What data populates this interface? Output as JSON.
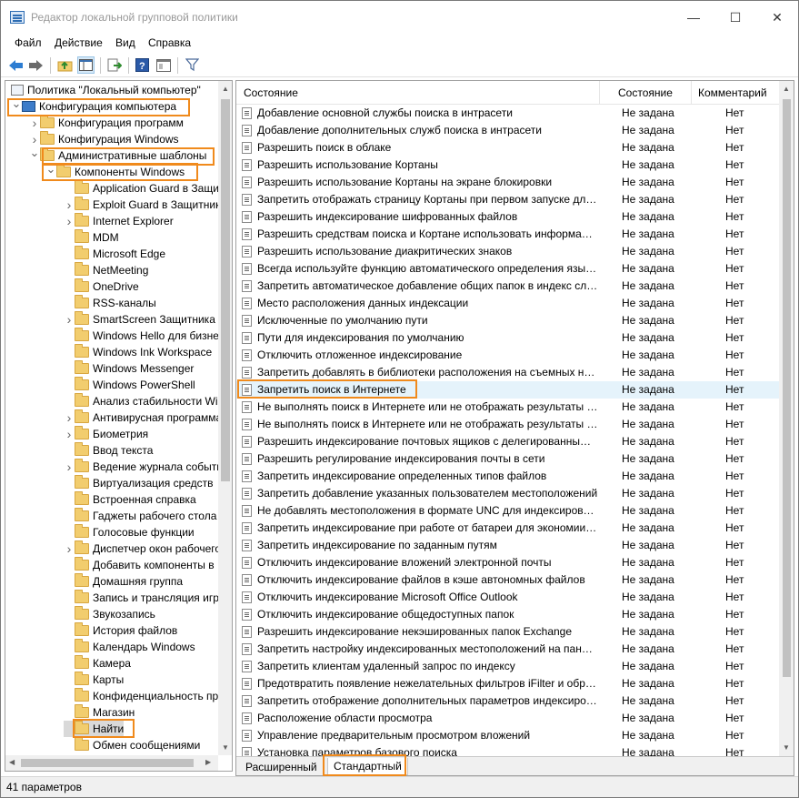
{
  "window": {
    "title": "Редактор локальной групповой политики",
    "minimize": "—",
    "maximize": "☐",
    "close": "✕"
  },
  "menu": [
    "Файл",
    "Действие",
    "Вид",
    "Справка"
  ],
  "toolbar": {
    "icons": [
      "back-icon",
      "forward-icon",
      "up-folder-icon",
      "show-hide-tree-icon",
      "export-list-icon",
      "help-icon",
      "extended-view-icon",
      "filter-icon"
    ]
  },
  "tree": {
    "root": "Политика \"Локальный компьютер\"",
    "items": [
      {
        "label": "Конфигурация компьютера",
        "level": 0,
        "expander": "open",
        "icon": "computer"
      },
      {
        "label": "Конфигурация программ",
        "level": 1,
        "expander": "closed",
        "icon": "folder"
      },
      {
        "label": "Конфигурация Windows",
        "level": 1,
        "expander": "closed",
        "icon": "folder"
      },
      {
        "label": "Административные шаблоны",
        "level": 1,
        "expander": "open",
        "icon": "folder"
      },
      {
        "label": "Компоненты Windows",
        "level": 2,
        "expander": "open",
        "icon": "folder"
      },
      {
        "label": "Application Guard в Защитнике",
        "level": 3,
        "expander": "",
        "icon": "folder"
      },
      {
        "label": "Exploit Guard в Защитнике",
        "level": 3,
        "expander": "closed",
        "icon": "folder"
      },
      {
        "label": "Internet Explorer",
        "level": 3,
        "expander": "closed",
        "icon": "folder"
      },
      {
        "label": "MDM",
        "level": 3,
        "expander": "",
        "icon": "folder"
      },
      {
        "label": "Microsoft Edge",
        "level": 3,
        "expander": "",
        "icon": "folder"
      },
      {
        "label": "NetMeeting",
        "level": 3,
        "expander": "",
        "icon": "folder"
      },
      {
        "label": "OneDrive",
        "level": 3,
        "expander": "",
        "icon": "folder"
      },
      {
        "label": "RSS-каналы",
        "level": 3,
        "expander": "",
        "icon": "folder"
      },
      {
        "label": "SmartScreen Защитника",
        "level": 3,
        "expander": "closed",
        "icon": "folder"
      },
      {
        "label": "Windows Hello для бизнеса",
        "level": 3,
        "expander": "",
        "icon": "folder"
      },
      {
        "label": "Windows Ink Workspace",
        "level": 3,
        "expander": "",
        "icon": "folder"
      },
      {
        "label": "Windows Messenger",
        "level": 3,
        "expander": "",
        "icon": "folder"
      },
      {
        "label": "Windows PowerShell",
        "level": 3,
        "expander": "",
        "icon": "folder"
      },
      {
        "label": "Анализ стабильности Windows",
        "level": 3,
        "expander": "",
        "icon": "folder"
      },
      {
        "label": "Антивирусная программа",
        "level": 3,
        "expander": "closed",
        "icon": "folder"
      },
      {
        "label": "Биометрия",
        "level": 3,
        "expander": "closed",
        "icon": "folder"
      },
      {
        "label": "Ввод текста",
        "level": 3,
        "expander": "",
        "icon": "folder"
      },
      {
        "label": "Ведение журнала событий",
        "level": 3,
        "expander": "closed",
        "icon": "folder"
      },
      {
        "label": "Виртуализация средств",
        "level": 3,
        "expander": "",
        "icon": "folder"
      },
      {
        "label": "Встроенная справка",
        "level": 3,
        "expander": "",
        "icon": "folder"
      },
      {
        "label": "Гаджеты рабочего стола",
        "level": 3,
        "expander": "",
        "icon": "folder"
      },
      {
        "label": "Голосовые функции",
        "level": 3,
        "expander": "",
        "icon": "folder"
      },
      {
        "label": "Диспетчер окон рабочего стола",
        "level": 3,
        "expander": "closed",
        "icon": "folder"
      },
      {
        "label": "Добавить компоненты в",
        "level": 3,
        "expander": "",
        "icon": "folder"
      },
      {
        "label": "Домашняя группа",
        "level": 3,
        "expander": "",
        "icon": "folder"
      },
      {
        "label": "Запись и трансляция игр",
        "level": 3,
        "expander": "",
        "icon": "folder"
      },
      {
        "label": "Звукозапись",
        "level": 3,
        "expander": "",
        "icon": "folder"
      },
      {
        "label": "История файлов",
        "level": 3,
        "expander": "",
        "icon": "folder"
      },
      {
        "label": "Календарь Windows",
        "level": 3,
        "expander": "",
        "icon": "folder"
      },
      {
        "label": "Камера",
        "level": 3,
        "expander": "",
        "icon": "folder"
      },
      {
        "label": "Карты",
        "level": 3,
        "expander": "",
        "icon": "folder"
      },
      {
        "label": "Конфиденциальность при",
        "level": 3,
        "expander": "",
        "icon": "folder"
      },
      {
        "label": "Магазин",
        "level": 3,
        "expander": "",
        "icon": "folder"
      },
      {
        "label": "Найти",
        "level": 3,
        "expander": "",
        "icon": "folder"
      },
      {
        "label": "Обмен сообщениями",
        "level": 3,
        "expander": "",
        "icon": "folder"
      }
    ]
  },
  "list": {
    "columns": [
      "Состояние",
      "Состояние",
      "Комментарий"
    ],
    "rows": [
      {
        "name": "Добавление основной службы поиска в интрасети",
        "state": "Не задана",
        "comment": "Нет"
      },
      {
        "name": "Добавление дополнительных служб поиска в интрасети",
        "state": "Не задана",
        "comment": "Нет"
      },
      {
        "name": "Разрешить поиск в облаке",
        "state": "Не задана",
        "comment": "Нет"
      },
      {
        "name": "Разрешить использование Кортаны",
        "state": "Не задана",
        "comment": "Нет"
      },
      {
        "name": "Разрешить использование Кортаны на экране блокировки",
        "state": "Не задана",
        "comment": "Нет"
      },
      {
        "name": "Запретить отображать страницу Кортаны при первом запуске для нового пользователя",
        "state": "Не задана",
        "comment": "Нет"
      },
      {
        "name": "Разрешить индексирование шифрованных файлов",
        "state": "Не задана",
        "comment": "Нет"
      },
      {
        "name": "Разрешить средствам поиска и Кортане использовать информацию о расположении",
        "state": "Не задана",
        "comment": "Нет"
      },
      {
        "name": "Разрешить использование диакритических знаков",
        "state": "Не задана",
        "comment": "Нет"
      },
      {
        "name": "Всегда используйте функцию автоматического определения языка при индексировании",
        "state": "Не задана",
        "comment": "Нет"
      },
      {
        "name": "Запретить автоматическое добавление общих папок в индекс службы поиска",
        "state": "Не задана",
        "comment": "Нет"
      },
      {
        "name": "Место расположения данных индексации",
        "state": "Не задана",
        "comment": "Нет"
      },
      {
        "name": "Исключенные по умолчанию пути",
        "state": "Не задана",
        "comment": "Нет"
      },
      {
        "name": "Пути для индексирования по умолчанию",
        "state": "Не задана",
        "comment": "Нет"
      },
      {
        "name": "Отключить отложенное индексирование",
        "state": "Не задана",
        "comment": "Нет"
      },
      {
        "name": "Запретить добавлять в библиотеки расположения на съемных носителях",
        "state": "Не задана",
        "comment": "Нет"
      },
      {
        "name": "Запретить поиск в Интернете",
        "state": "Не задана",
        "comment": "Нет"
      },
      {
        "name": "Не выполнять поиск в Интернете или не отображать результаты поиска",
        "state": "Не задана",
        "comment": "Нет"
      },
      {
        "name": "Не выполнять поиск в Интернете или не отображать результаты при лимитном подключении",
        "state": "Не задана",
        "comment": "Нет"
      },
      {
        "name": "Разрешить индексирование почтовых ящиков с делегированным доступом",
        "state": "Не задана",
        "comment": "Нет"
      },
      {
        "name": "Разрешить регулирование индексирования почты в сети",
        "state": "Не задана",
        "comment": "Нет"
      },
      {
        "name": "Запретить индексирование определенных типов файлов",
        "state": "Не задана",
        "comment": "Нет"
      },
      {
        "name": "Запретить добавление указанных пользователем местоположений",
        "state": "Не задана",
        "comment": "Нет"
      },
      {
        "name": "Не добавлять местоположения в формате UNC для индексирования",
        "state": "Не задана",
        "comment": "Нет"
      },
      {
        "name": "Запретить индексирование при работе от батареи для экономии энергии",
        "state": "Не задана",
        "comment": "Нет"
      },
      {
        "name": "Запретить индексирование по заданным путям",
        "state": "Не задана",
        "comment": "Нет"
      },
      {
        "name": "Отключить индексирование вложений электронной почты",
        "state": "Не задана",
        "comment": "Нет"
      },
      {
        "name": "Отключить индексирование файлов в кэше автономных файлов",
        "state": "Не задана",
        "comment": "Нет"
      },
      {
        "name": "Отключить индексирование Microsoft Office Outlook",
        "state": "Не задана",
        "comment": "Нет"
      },
      {
        "name": "Отключить индексирование общедоступных папок",
        "state": "Не задана",
        "comment": "Нет"
      },
      {
        "name": "Разрешить индексирование некэшированных папок Exchange",
        "state": "Не задана",
        "comment": "Нет"
      },
      {
        "name": "Запретить настройку индексированных местоположений на панели управления",
        "state": "Не задана",
        "comment": "Нет"
      },
      {
        "name": "Запретить клиентам удаленный запрос по индексу",
        "state": "Не задана",
        "comment": "Нет"
      },
      {
        "name": "Предотвратить появление нежелательных фильтров iFilter и обработчиков протокола",
        "state": "Не задана",
        "comment": "Нет"
      },
      {
        "name": "Запретить отображение дополнительных параметров индексирования",
        "state": "Не задана",
        "comment": "Нет"
      },
      {
        "name": "Расположение области просмотра",
        "state": "Не задана",
        "comment": "Нет"
      },
      {
        "name": "Управление предварительным просмотром вложений",
        "state": "Не задана",
        "comment": "Нет"
      },
      {
        "name": "Установка параметров базового поиска",
        "state": "Не задана",
        "comment": "Нет"
      }
    ]
  },
  "tabs": [
    "Расширенный",
    "Стандартный"
  ],
  "status": "41 параметров",
  "colors": {
    "highlight": "#f08a1c",
    "selection": "#e5f3fb"
  }
}
